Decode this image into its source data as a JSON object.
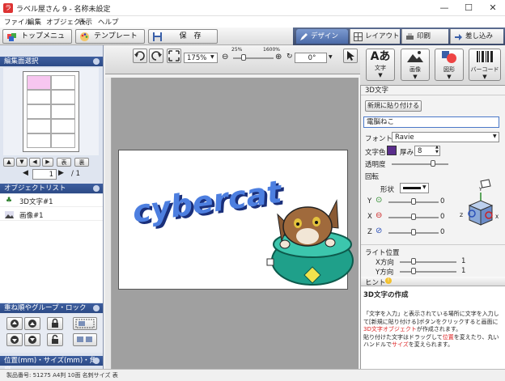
{
  "window": {
    "title": "ラベル屋さん 9 - 名称未設定",
    "minimize": "—",
    "maximize": "☐",
    "close": "✕"
  },
  "menu": [
    "ファイル",
    "編集",
    "オブジェクト",
    "表示",
    "ヘルプ"
  ],
  "toolbar": {
    "top_menu": "トップメニュー",
    "template": "テンプレート",
    "save": "保　存"
  },
  "mode_tabs": [
    {
      "label": "デザイン",
      "active": true
    },
    {
      "label": "レイアウト",
      "active": false
    },
    {
      "label": "印刷",
      "active": false
    },
    {
      "label": "差し込み",
      "active": false
    }
  ],
  "left": {
    "page_select_title": "編集面選択",
    "page_nav": {
      "table_btn1": "表",
      "table_btn2": "裏",
      "current_page": "1",
      "total_pages": "/ 1"
    },
    "object_list_title": "オブジェクトリスト",
    "objects": [
      "3D文字#1",
      "画像#1"
    ],
    "order_title": "重ね順やグループ・ロック",
    "position_title": "位置(mm)・サイズ(mm)・角度"
  },
  "work": {
    "zoom": "175%",
    "zoom_min": "25%",
    "zoom_max": "1600%",
    "angle": "0°"
  },
  "canvas": {
    "text_3d": "cybercat"
  },
  "shapes": {
    "text": "文字",
    "image": "画像",
    "figure": "図形",
    "barcode": "バーコード"
  },
  "props": {
    "title": "3D文字",
    "paste_new": "新規に貼り付ける",
    "text_value": "電脳ねこ",
    "font_label": "フォント",
    "font_value": "Ravie",
    "color_label": "文字色",
    "thickness_label": "厚み",
    "thickness_value": "8",
    "transparency_label": "透明度",
    "rotation_label": "回転",
    "shape_label": "形状",
    "axis_y": "Y",
    "axis_x": "X",
    "axis_z": "Z",
    "y_value": "0",
    "x_value": "0",
    "z_value": "0",
    "light_title": "ライト位置",
    "light_x_label": "X方向",
    "light_y_label": "Y方向",
    "light_x_value": "1",
    "light_y_value": "1",
    "text_color": "#5a2d8c"
  },
  "hint": {
    "title": "ヒント",
    "heading": "3D文字の作成",
    "body1": "「文字を入力」と表示されている場所に文字を入力し",
    "body2": "て[新規に貼り付ける]ボタンをクリックすると画面に",
    "body3_red": "3D文字オブジェクト",
    "body3_rest": "が作成されます。",
    "body4a": "貼り付けた文字はドラッグして",
    "body4_red": "位置",
    "body4b": "を変えたり、丸い",
    "body5a": "ハンドルで",
    "body5_red": "サイズ",
    "body5b": "を変えられます。"
  },
  "status": "製品番号: 51275 A4判 10面 名刺サイズ 表"
}
